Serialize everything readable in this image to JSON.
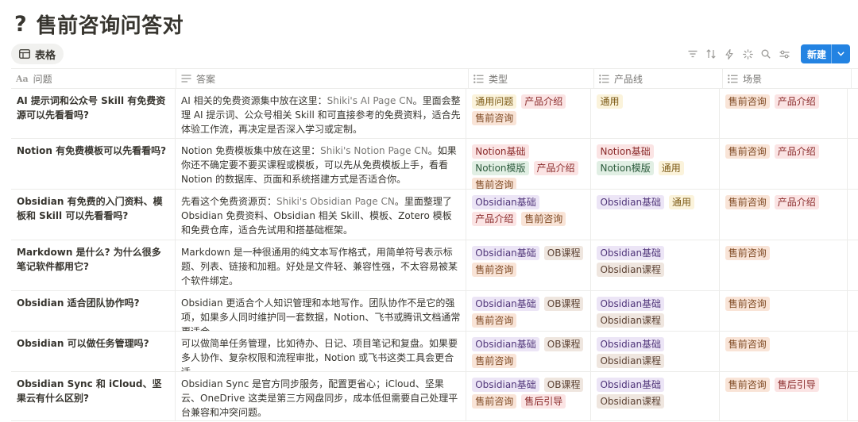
{
  "page": {
    "icon": "?",
    "title": "售前咨询问答对"
  },
  "view": {
    "tab_label": "表格",
    "tab_icon": "table-icon"
  },
  "toolbar": {
    "icons": [
      "filter-icon",
      "sort-icon",
      "automation-icon",
      "ai-icon",
      "search-icon",
      "settings-icon"
    ],
    "new_label": "新建"
  },
  "columns": [
    {
      "label": "问题",
      "icon": "text-icon"
    },
    {
      "label": "答案",
      "icon": "list-icon"
    },
    {
      "label": "类型",
      "icon": "multi-select-icon"
    },
    {
      "label": "产品线",
      "icon": "multi-select-icon"
    },
    {
      "label": "场景",
      "icon": "multi-select-icon"
    }
  ],
  "tag_colors": {
    "yellow": {
      "bg": "#fbf3db",
      "fg": "#7c5a16"
    },
    "red": {
      "bg": "#fbe4e4",
      "fg": "#8a2b2b"
    },
    "orange": {
      "bg": "#f9e4d7",
      "fg": "#7f4a24"
    },
    "green": {
      "bg": "#e1efe4",
      "fg": "#2c5b3c"
    },
    "purple": {
      "bg": "#ece5f6",
      "fg": "#503579"
    },
    "brown": {
      "bg": "#efe6df",
      "fg": "#5c4234"
    }
  },
  "rows": [
    {
      "question": "AI 提示词和公众号 Skill 有免费资源可以先看看吗?",
      "answer_pre": "AI 相关的免费资源集中放在这里：",
      "answer_link": "Shiki's AI Page CN",
      "answer_post": "。里面会整理 AI 提示词、公众号相关 Skill 和可直接参考的免费资料，适合先体验工作流，再决定是否深入学习或定制。",
      "type": [
        {
          "label": "通用问题",
          "color": "yellow"
        },
        {
          "label": "产品介绍",
          "color": "red"
        },
        {
          "label": "售前咨询",
          "color": "orange"
        }
      ],
      "product": [
        {
          "label": "通用",
          "color": "yellow"
        }
      ],
      "scene": [
        {
          "label": "售前咨询",
          "color": "orange"
        },
        {
          "label": "产品介绍",
          "color": "red"
        }
      ]
    },
    {
      "question": "Notion 有免费模板可以先看看吗?",
      "answer_pre": "Notion 免费模板集中放在这里：",
      "answer_link": "Shiki's Notion Page CN",
      "answer_post": "。如果你还不确定要不要买课程或模板，可以先从免费模板上手，看看 Notion 的数据库、页面和系统搭建方式是否适合你。",
      "type": [
        {
          "label": "Notion基础",
          "color": "red"
        },
        {
          "label": "Notion模版",
          "color": "green"
        },
        {
          "label": "产品介绍",
          "color": "red"
        },
        {
          "label": "售前咨询",
          "color": "orange"
        }
      ],
      "product": [
        {
          "label": "Notion基础",
          "color": "red"
        },
        {
          "label": "Notion模版",
          "color": "green"
        },
        {
          "label": "通用",
          "color": "yellow"
        }
      ],
      "scene": [
        {
          "label": "售前咨询",
          "color": "orange"
        },
        {
          "label": "产品介绍",
          "color": "red"
        }
      ]
    },
    {
      "question": "Obsidian 有免费的入门资料、模板和 Skill 可以先看看吗?",
      "answer_pre": "先看这个免费资源页：",
      "answer_link": "Shiki's Obsidian Page CN",
      "answer_post": "。里面整理了 Obsidian 免费资料、Obsidian 相关 Skill、模板、Zotero 模板和免费仓库，适合先试用和搭基础框架。",
      "type": [
        {
          "label": "Obsidian基础",
          "color": "purple"
        },
        {
          "label": "产品介绍",
          "color": "red"
        },
        {
          "label": "售前咨询",
          "color": "orange"
        }
      ],
      "product": [
        {
          "label": "Obsidian基础",
          "color": "purple"
        },
        {
          "label": "通用",
          "color": "yellow"
        }
      ],
      "scene": [
        {
          "label": "售前咨询",
          "color": "orange"
        },
        {
          "label": "产品介绍",
          "color": "red"
        }
      ]
    },
    {
      "question": "Markdown 是什么? 为什么很多笔记软件都用它?",
      "answer_pre": "Markdown 是一种很通用的纯文本写作格式，用简单符号表示标题、列表、链接和加粗。好处是文件轻、兼容性强，不太容易被某个软件绑定。",
      "answer_link": "",
      "answer_post": "",
      "type": [
        {
          "label": "Obsidian基础",
          "color": "purple"
        },
        {
          "label": "OB课程",
          "color": "brown"
        },
        {
          "label": "售前咨询",
          "color": "orange"
        }
      ],
      "product": [
        {
          "label": "Obsidian基础",
          "color": "purple"
        },
        {
          "label": "Obsidian课程",
          "color": "brown"
        }
      ],
      "scene": [
        {
          "label": "售前咨询",
          "color": "orange"
        }
      ]
    },
    {
      "question": "Obsidian 适合团队协作吗?",
      "answer_pre": "Obsidian 更适合个人知识管理和本地写作。团队协作不是它的强项，如果多人同时维护同一套数据，Notion、飞书或腾讯文档通常更适合。",
      "answer_link": "",
      "answer_post": "",
      "type": [
        {
          "label": "Obsidian基础",
          "color": "purple"
        },
        {
          "label": "OB课程",
          "color": "brown"
        },
        {
          "label": "售前咨询",
          "color": "orange"
        }
      ],
      "product": [
        {
          "label": "Obsidian基础",
          "color": "purple"
        },
        {
          "label": "Obsidian课程",
          "color": "brown"
        }
      ],
      "scene": [
        {
          "label": "售前咨询",
          "color": "orange"
        }
      ]
    },
    {
      "question": "Obsidian 可以做任务管理吗?",
      "answer_pre": "可以做简单任务管理，比如待办、日记、项目笔记和复盘。如果要多人协作、复杂权限和流程审批，Notion 或飞书这类工具会更合适。",
      "answer_link": "",
      "answer_post": "",
      "type": [
        {
          "label": "Obsidian基础",
          "color": "purple"
        },
        {
          "label": "OB课程",
          "color": "brown"
        },
        {
          "label": "售前咨询",
          "color": "orange"
        }
      ],
      "product": [
        {
          "label": "Obsidian基础",
          "color": "purple"
        },
        {
          "label": "Obsidian课程",
          "color": "brown"
        }
      ],
      "scene": [
        {
          "label": "售前咨询",
          "color": "orange"
        }
      ]
    },
    {
      "question": "Obsidian Sync 和 iCloud、坚果云有什么区别?",
      "answer_pre": "Obsidian Sync 是官方同步服务，配置更省心；iCloud、坚果云、OneDrive 这类是第三方网盘同步，成本低但需要自己处理平台兼容和冲突问题。",
      "answer_link": "",
      "answer_post": "",
      "type": [
        {
          "label": "Obsidian基础",
          "color": "purple"
        },
        {
          "label": "OB课程",
          "color": "brown"
        },
        {
          "label": "售前咨询",
          "color": "orange"
        },
        {
          "label": "售后引导",
          "color": "red"
        }
      ],
      "product": [
        {
          "label": "Obsidian基础",
          "color": "purple"
        },
        {
          "label": "Obsidian课程",
          "color": "brown"
        }
      ],
      "scene": [
        {
          "label": "售前咨询",
          "color": "orange"
        },
        {
          "label": "售后引导",
          "color": "red"
        }
      ]
    }
  ]
}
